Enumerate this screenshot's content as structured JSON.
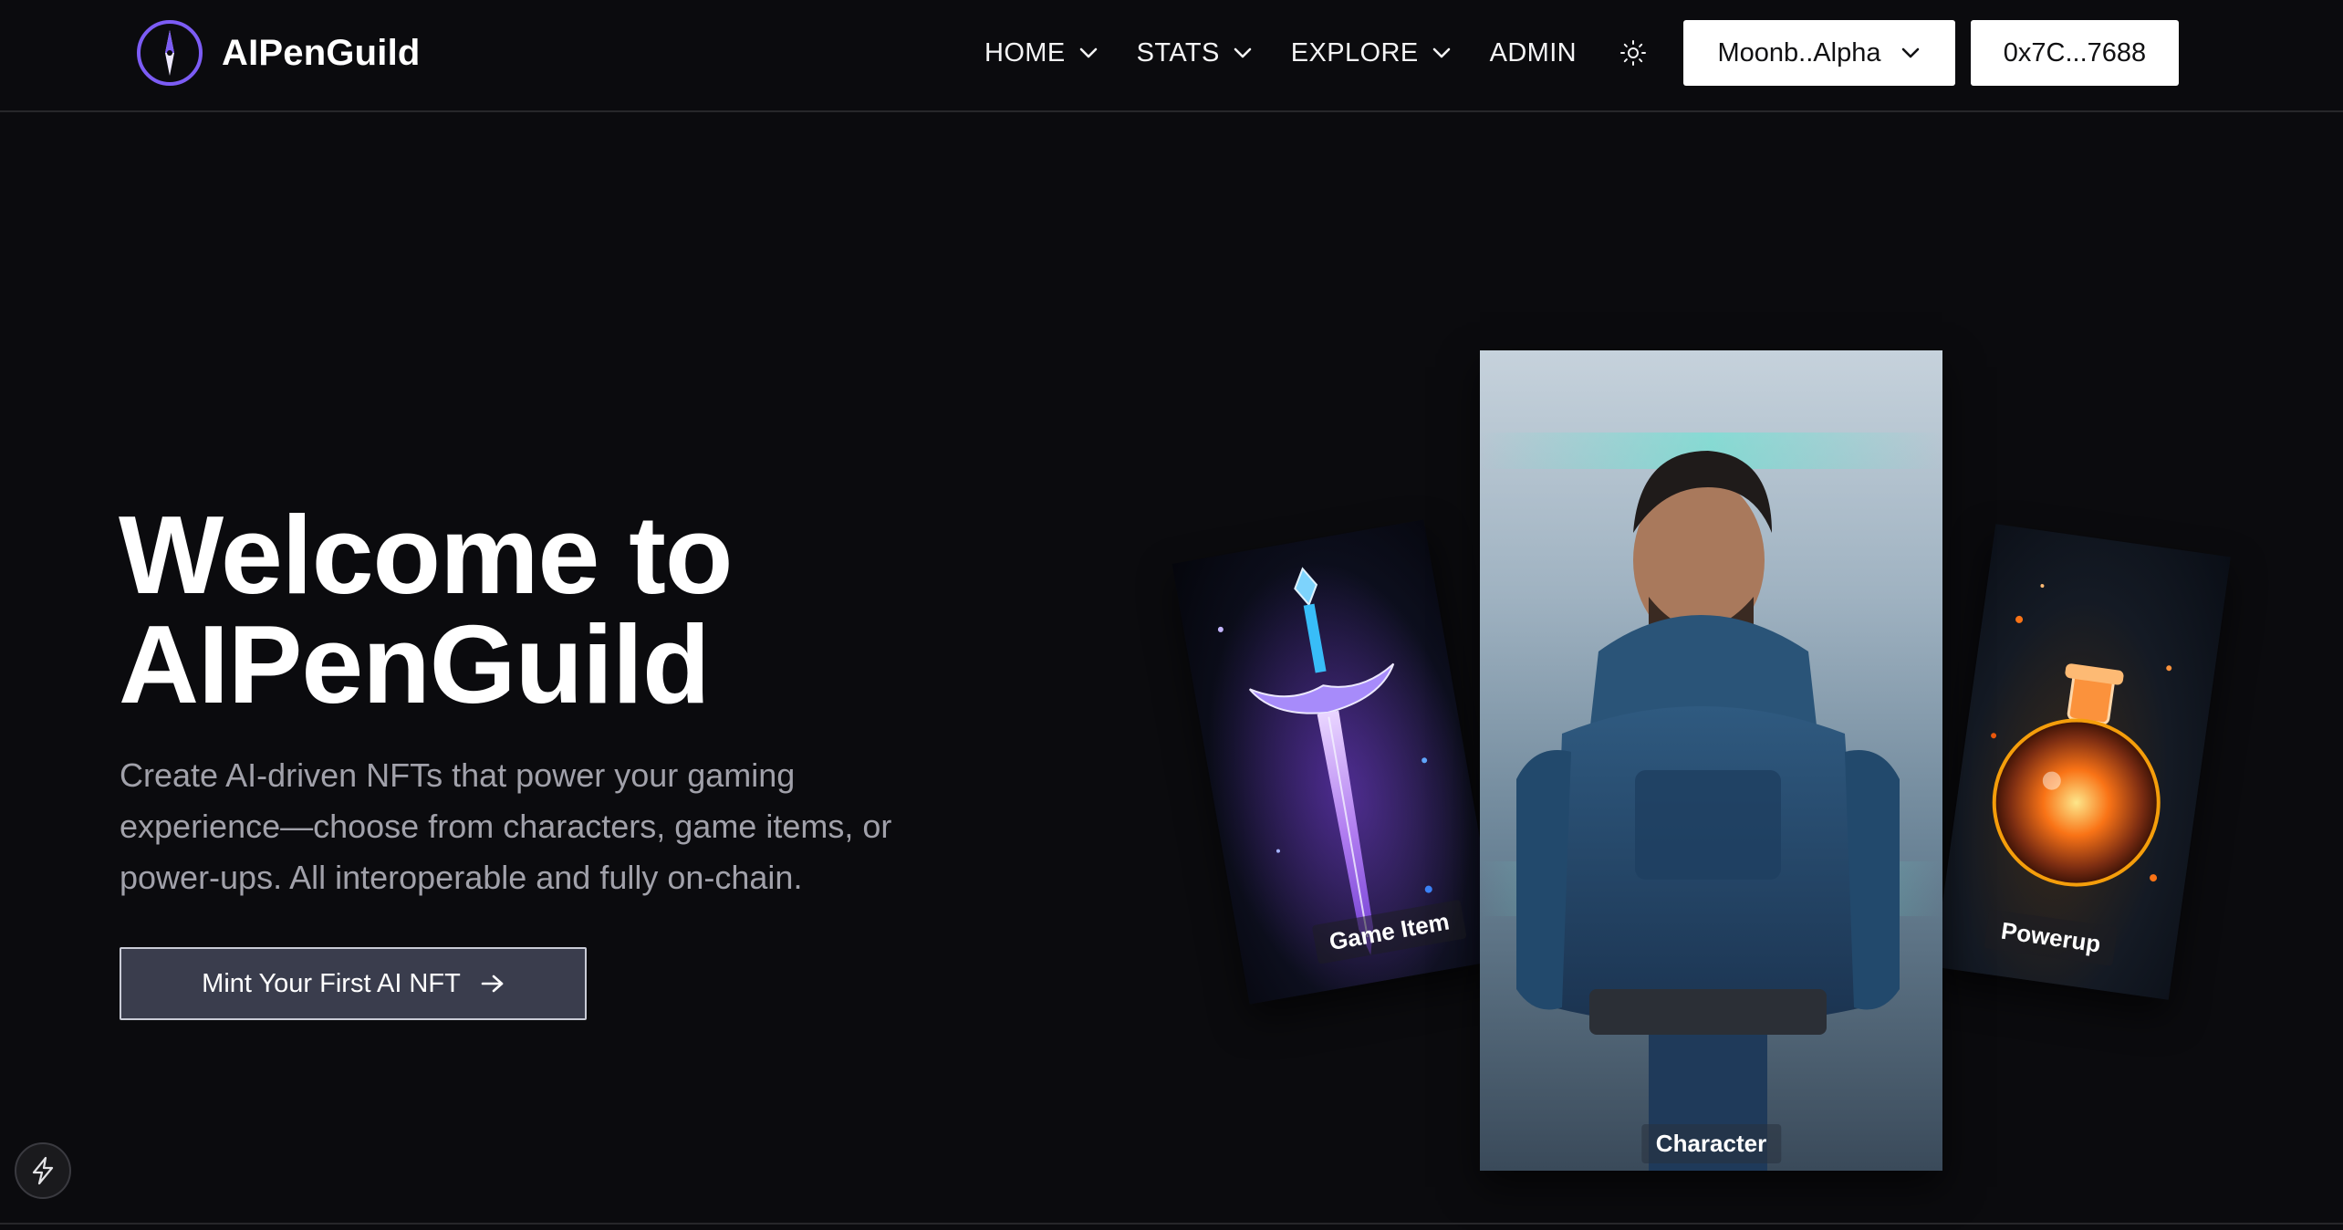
{
  "brand": {
    "name": "AIPenGuild",
    "logo_icon": "compass-icon",
    "accent_color": "#7c5cf5"
  },
  "nav": {
    "items": [
      {
        "label": "HOME",
        "has_dropdown": true
      },
      {
        "label": "STATS",
        "has_dropdown": true
      },
      {
        "label": "EXPLORE",
        "has_dropdown": true
      },
      {
        "label": "ADMIN",
        "has_dropdown": false
      }
    ],
    "theme_icon": "sun-icon"
  },
  "network": {
    "label": "Moonb..Alpha"
  },
  "wallet": {
    "label": "0x7C...7688"
  },
  "hero": {
    "title_line1": "Welcome to",
    "title_line2": "AIPenGuild",
    "description": "Create AI-driven NFTs that power your gaming experience—choose from characters, game items, or power-ups. All interoperable and fully on-chain.",
    "cta_label": "Mint Your First AI NFT"
  },
  "cards": {
    "left": {
      "label": "Game Item"
    },
    "center": {
      "label": "Character"
    },
    "right": {
      "label": "Powerup"
    }
  },
  "floating": {
    "icon": "bolt-icon"
  }
}
